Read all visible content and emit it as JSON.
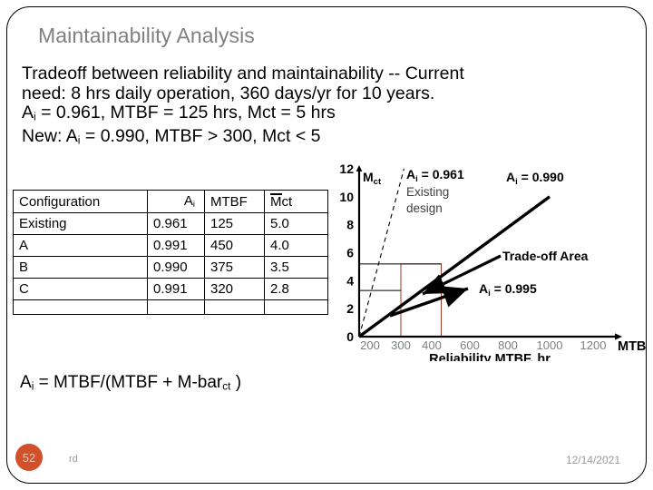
{
  "slide": {
    "title": "Maintainability Analysis",
    "body_lines": [
      "Tradeoff between reliability and maintainability --  Current",
      "need: 8 hrs daily operation, 360 days/yr for 10 years.",
      "A",
      "New: A"
    ],
    "line3_prefix": "A",
    "line3_sub": "i",
    "line3_rest": " = 0.961, MTBF = 125 hrs, Mct = 5 hrs",
    "line4_prefix": "New: A",
    "line4_sub": "i",
    "line4_rest": " = 0.990, MTBF > 300, Mct < 5"
  },
  "table": {
    "headers": {
      "configuration": "Configuration",
      "ai": "A",
      "ai_sub": "i",
      "mtbf": "MTBF",
      "mct_m": "M",
      "mct_ct": "ct"
    },
    "rows": [
      {
        "configuration": "Existing",
        "ai": "0.961",
        "mtbf": "125",
        "mct": "5.0"
      },
      {
        "configuration": "A",
        "ai": "0.991",
        "mtbf": "450",
        "mct": "4.0"
      },
      {
        "configuration": "B",
        "ai": "0.990",
        "mtbf": "375",
        "mct": "3.5"
      },
      {
        "configuration": "C",
        "ai": "0.991",
        "mtbf": "320",
        "mct": "2.8"
      }
    ]
  },
  "formula": {
    "prefix": "A",
    "sub": "i",
    "rest": " = MTBF/(MTBF + M-bar",
    "rest_sub": "ct",
    "suffix": " )"
  },
  "chart_data": {
    "type": "line",
    "title": "",
    "xlabel": "Reliability MTBF, hr",
    "ylabel": "Mct",
    "ylabel_main": "M",
    "ylabel_sub": "ct",
    "x_axis_end_label": "MTBF",
    "xticks": [
      "200",
      "300",
      "400",
      "600",
      "800",
      "1000",
      "1200"
    ],
    "xtick_values": [
      200,
      300,
      400,
      600,
      800,
      1000,
      1200
    ],
    "yticks": [
      "0",
      "2",
      "4",
      "6",
      "8",
      "10",
      "12"
    ],
    "ytick_values": [
      0,
      2,
      4,
      6,
      8,
      10,
      12
    ],
    "ylim": [
      0,
      12
    ],
    "grid": false,
    "series": [
      {
        "name": "A_i = 0.961 Existing design",
        "style": "dashed",
        "label": "A",
        "label_sub": "i",
        "label_rest": " = 0.961",
        "sublabel_1": "Existing",
        "sublabel_2": "design",
        "points": [
          [
            0,
            0
          ],
          [
            310,
            12
          ]
        ]
      },
      {
        "name": "A_i = 0.990",
        "style": "solid-thick",
        "label": "A",
        "label_sub": "i",
        "label_rest": " = 0.990",
        "points": [
          [
            0,
            0
          ],
          [
            1000,
            10
          ]
        ]
      },
      {
        "name": "A_i = 0.995",
        "style": "solid-thick-arrow",
        "label": "A",
        "label_sub": "i",
        "label_rest": " = 0.995",
        "points": [
          [
            0,
            0
          ],
          [
            1000,
            5
          ]
        ]
      }
    ],
    "reference_lines_y": [
      5.2,
      3.3
    ],
    "tradeoff_box": {
      "x_min": 300,
      "x_max": 450,
      "y_min": 0,
      "y_max": 5.2,
      "color": "#a03a2a"
    },
    "annotations": [
      {
        "text": "Trade-off Area",
        "bold": true
      }
    ]
  },
  "footer": {
    "page_number": "52",
    "author": "rd",
    "date": "12/14/2021"
  }
}
